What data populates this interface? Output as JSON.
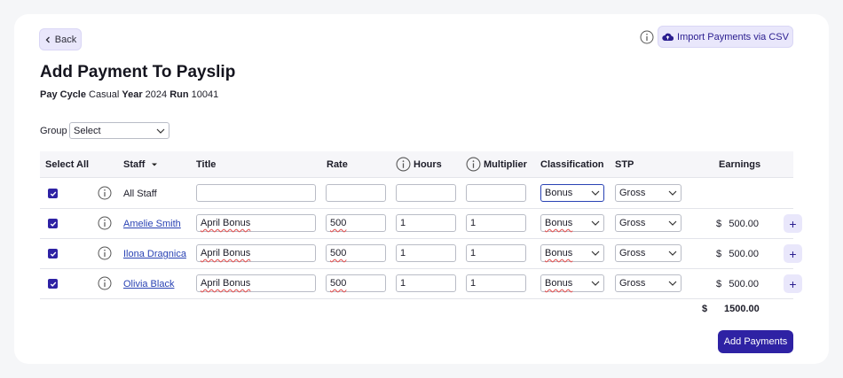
{
  "header": {
    "back_label": "Back",
    "import_label": "Import Payments via CSV",
    "title": "Add Payment To Payslip"
  },
  "meta": {
    "pay_cycle_label": "Pay Cycle",
    "pay_cycle_value": "Casual",
    "year_label": "Year",
    "year_value": "2024",
    "run_label": "Run",
    "run_value": "10041"
  },
  "group": {
    "label": "Group",
    "value": "Select"
  },
  "columns": {
    "select_all": "Select All",
    "staff": "Staff",
    "title": "Title",
    "rate": "Rate",
    "hours": "Hours",
    "multiplier": "Multiplier",
    "classification": "Classification",
    "stp": "STP",
    "earnings": "Earnings"
  },
  "all_row": {
    "staff": "All Staff",
    "title": "",
    "rate": "",
    "hours": "",
    "multiplier": "",
    "classification": "Bonus",
    "stp": "Gross"
  },
  "rows": [
    {
      "staff": "Amelie Smith",
      "title": "April Bonus",
      "rate": "500",
      "hours": "1",
      "multiplier": "1",
      "classification": "Bonus",
      "stp": "Gross",
      "currency": "$",
      "earnings": "500.00"
    },
    {
      "staff": "Ilona Dragnica",
      "title": "April Bonus",
      "rate": "500",
      "hours": "1",
      "multiplier": "1",
      "classification": "Bonus",
      "stp": "Gross",
      "currency": "$",
      "earnings": "500.00"
    },
    {
      "staff": "Olivia Black",
      "title": "April Bonus",
      "rate": "500",
      "hours": "1",
      "multiplier": "1",
      "classification": "Bonus",
      "stp": "Gross",
      "currency": "$",
      "earnings": "500.00"
    }
  ],
  "total": {
    "currency": "$",
    "value": "1500.00"
  },
  "footer": {
    "add_label": "Add Payments"
  },
  "colors": {
    "accent": "#2e22a4",
    "accent_light": "#e9e7fb",
    "link": "#2942b4"
  }
}
